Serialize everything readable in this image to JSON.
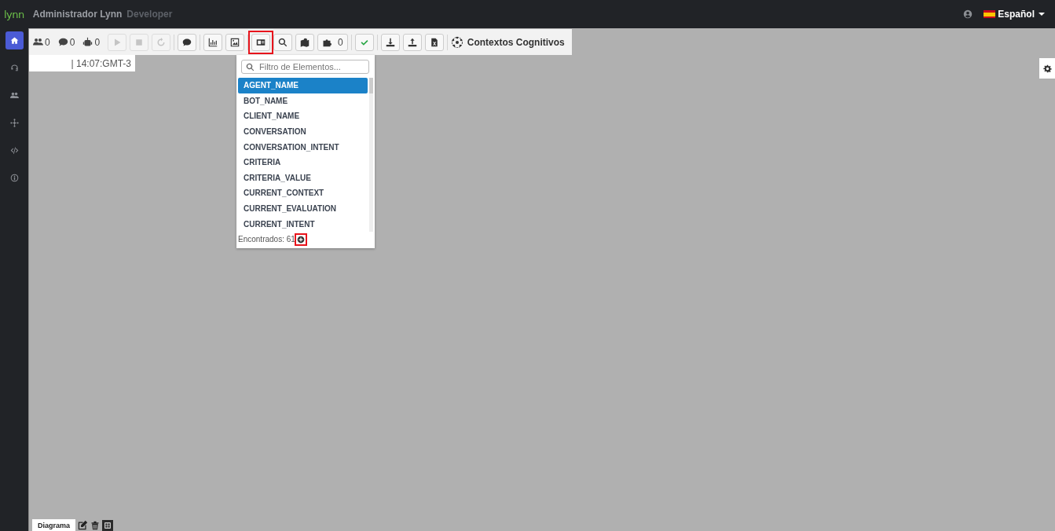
{
  "header": {
    "logo": "lynn",
    "user": "Administrador Lynn",
    "role": "Developer",
    "language": "Español"
  },
  "sidebar": {
    "items": [
      {
        "kind": "home",
        "selected": true
      },
      {
        "kind": "headset",
        "selected": false
      },
      {
        "kind": "users",
        "selected": false
      },
      {
        "kind": "network",
        "selected": false
      },
      {
        "kind": "code",
        "selected": false
      },
      {
        "kind": "info",
        "selected": false
      }
    ]
  },
  "toolbar": {
    "counters": [
      {
        "kind": "users",
        "value": "0"
      },
      {
        "kind": "chat",
        "value": "0"
      },
      {
        "kind": "robot",
        "value": "0"
      }
    ],
    "buttons": [
      {
        "kind": "play",
        "disabled": true,
        "highlighted": false
      },
      {
        "kind": "stop",
        "disabled": true,
        "highlighted": false
      },
      {
        "kind": "refresh",
        "disabled": true,
        "highlighted": false
      },
      {
        "kind": "chat",
        "disabled": false,
        "highlighted": false
      },
      {
        "kind": "chart",
        "disabled": false,
        "highlighted": false
      },
      {
        "kind": "image",
        "disabled": false,
        "highlighted": false
      },
      {
        "kind": "idcard",
        "disabled": false,
        "highlighted": true
      },
      {
        "kind": "search",
        "disabled": false,
        "highlighted": false
      },
      {
        "kind": "map",
        "disabled": false,
        "highlighted": false
      },
      {
        "kind": "puzzle",
        "disabled": false,
        "highlighted": false,
        "count": "0"
      },
      {
        "kind": "check",
        "disabled": false,
        "highlighted": false
      },
      {
        "kind": "download",
        "disabled": false,
        "highlighted": false
      },
      {
        "kind": "upload",
        "disabled": false,
        "highlighted": false
      },
      {
        "kind": "excel",
        "disabled": false,
        "highlighted": false
      }
    ],
    "context_label": "Contextos Cognitivos"
  },
  "clock": "| 14:07:GMT-3",
  "dropdown": {
    "placeholder": "Filtro de Elementos...",
    "items": [
      {
        "label": "AGENT_NAME",
        "selected": true
      },
      {
        "label": "BOT_NAME",
        "selected": false
      },
      {
        "label": "CLIENT_NAME",
        "selected": false
      },
      {
        "label": "CONVERSATION",
        "selected": false
      },
      {
        "label": "CONVERSATION_INTENT",
        "selected": false
      },
      {
        "label": "CRITERIA",
        "selected": false
      },
      {
        "label": "CRITERIA_VALUE",
        "selected": false
      },
      {
        "label": "CURRENT_CONTEXT",
        "selected": false
      },
      {
        "label": "CURRENT_EVALUATION",
        "selected": false
      },
      {
        "label": "CURRENT_INTENT",
        "selected": false
      }
    ],
    "footer": "Encontrados: 61",
    "add_highlighted": true
  },
  "bottom_tabs": {
    "label": "Diagrama"
  }
}
